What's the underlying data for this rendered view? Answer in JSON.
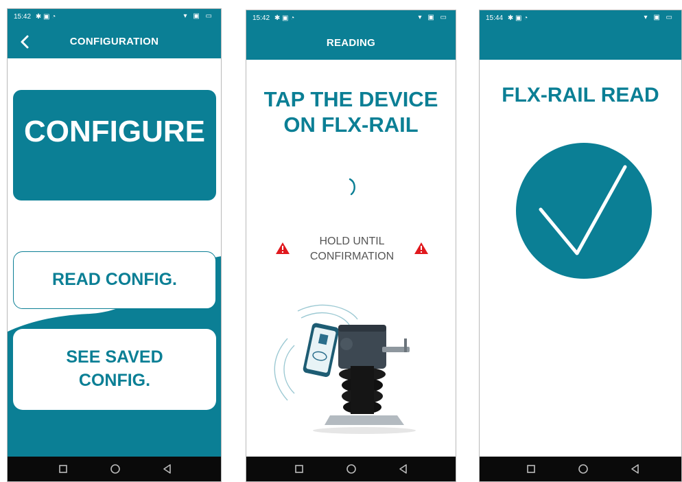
{
  "screens": [
    {
      "status": {
        "time": "15:42",
        "icons": "✱ ▣ ◔",
        "right_icons": "▾ ▣ ▭"
      },
      "title": "CONFIGURATION",
      "configure_label": "CONFIGURE",
      "read_label": "READ CONFIG.",
      "saved_label": "SEE SAVED CONFIG."
    },
    {
      "status": {
        "time": "15:42",
        "icons": "✱ ▣ ◔",
        "right_icons": "▾ ▣ ▭"
      },
      "title": "READING",
      "heading": "TAP THE DEVICE ON FLX-RAIL",
      "hold_text": "HOLD UNTIL CONFIRMATION"
    },
    {
      "status": {
        "time": "15:44",
        "icons": "✱ ▣ ◔",
        "right_icons": "▾ ▣ ▭"
      },
      "title": "",
      "heading": "FLX-RAIL READ"
    }
  ],
  "colors": {
    "teal": "#0b7f95",
    "warning": "#e0191e",
    "navbar": "#0a0a0a"
  },
  "icons": [
    "back-arrow-icon",
    "spinner-icon",
    "warning-icon",
    "nfc-phone-icon",
    "checkmark-icon",
    "square-nav-icon",
    "circle-nav-icon",
    "triangle-nav-icon"
  ]
}
